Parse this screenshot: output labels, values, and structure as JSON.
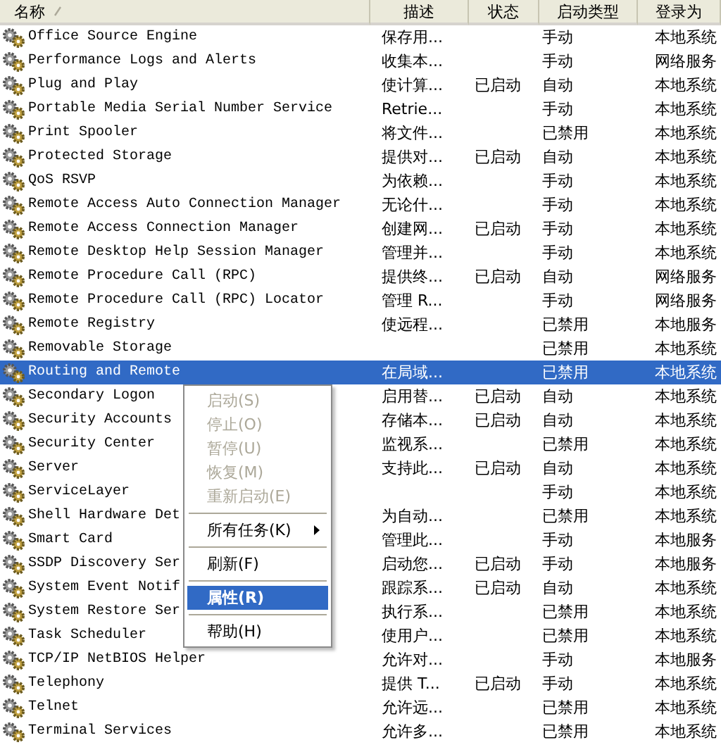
{
  "columns": [
    "名称",
    "描述",
    "状态",
    "启动类型",
    "登录为"
  ],
  "rows": [
    {
      "name": "Office Source Engine",
      "description": "保存用...",
      "status": "",
      "startup": "手动",
      "logon": "本地系统",
      "selected": false
    },
    {
      "name": "Performance Logs and Alerts",
      "description": "收集本...",
      "status": "",
      "startup": "手动",
      "logon": "网络服务",
      "selected": false
    },
    {
      "name": "Plug and Play",
      "description": "使计算...",
      "status": "已启动",
      "startup": "自动",
      "logon": "本地系统",
      "selected": false
    },
    {
      "name": "Portable Media Serial Number Service",
      "description": "Retrie...",
      "status": "",
      "startup": "手动",
      "logon": "本地系统",
      "selected": false
    },
    {
      "name": "Print Spooler",
      "description": "将文件...",
      "status": "",
      "startup": "已禁用",
      "logon": "本地系统",
      "selected": false
    },
    {
      "name": "Protected Storage",
      "description": "提供对...",
      "status": "已启动",
      "startup": "自动",
      "logon": "本地系统",
      "selected": false
    },
    {
      "name": "QoS RSVP",
      "description": "为依赖...",
      "status": "",
      "startup": "手动",
      "logon": "本地系统",
      "selected": false
    },
    {
      "name": "Remote Access Auto Connection Manager",
      "description": "无论什...",
      "status": "",
      "startup": "手动",
      "logon": "本地系统",
      "selected": false
    },
    {
      "name": "Remote Access Connection Manager",
      "description": "创建网...",
      "status": "已启动",
      "startup": "手动",
      "logon": "本地系统",
      "selected": false
    },
    {
      "name": "Remote Desktop Help Session Manager",
      "description": "管理并...",
      "status": "",
      "startup": "手动",
      "logon": "本地系统",
      "selected": false
    },
    {
      "name": "Remote Procedure Call (RPC)",
      "description": "提供终...",
      "status": "已启动",
      "startup": "自动",
      "logon": "网络服务",
      "selected": false
    },
    {
      "name": "Remote Procedure Call (RPC) Locator",
      "description": "管理 R...",
      "status": "",
      "startup": "手动",
      "logon": "网络服务",
      "selected": false
    },
    {
      "name": "Remote Registry",
      "description": "使远程...",
      "status": "",
      "startup": "已禁用",
      "logon": "本地服务",
      "selected": false
    },
    {
      "name": "Removable Storage",
      "description": "",
      "status": "",
      "startup": "已禁用",
      "logon": "本地系统",
      "selected": false
    },
    {
      "name": "Routing and Remote",
      "description": "在局域...",
      "status": "",
      "startup": "已禁用",
      "logon": "本地系统",
      "selected": true
    },
    {
      "name": "Secondary Logon",
      "description": "启用替...",
      "status": "已启动",
      "startup": "自动",
      "logon": "本地系统",
      "selected": false
    },
    {
      "name": "Security Accounts",
      "description": "存储本...",
      "status": "已启动",
      "startup": "自动",
      "logon": "本地系统",
      "selected": false
    },
    {
      "name": "Security Center",
      "description": "监视系...",
      "status": "",
      "startup": "已禁用",
      "logon": "本地系统",
      "selected": false
    },
    {
      "name": "Server",
      "description": "支持此...",
      "status": "已启动",
      "startup": "自动",
      "logon": "本地系统",
      "selected": false
    },
    {
      "name": "ServiceLayer",
      "description": "",
      "status": "",
      "startup": "手动",
      "logon": "本地系统",
      "selected": false
    },
    {
      "name": "Shell Hardware Det",
      "description": "为自动...",
      "status": "",
      "startup": "已禁用",
      "logon": "本地系统",
      "selected": false
    },
    {
      "name": "Smart Card",
      "description": "管理此...",
      "status": "",
      "startup": "手动",
      "logon": "本地服务",
      "selected": false
    },
    {
      "name": "SSDP Discovery Ser",
      "description": "启动您...",
      "status": "已启动",
      "startup": "手动",
      "logon": "本地服务",
      "selected": false
    },
    {
      "name": "System Event Notif",
      "description": "跟踪系...",
      "status": "已启动",
      "startup": "自动",
      "logon": "本地系统",
      "selected": false
    },
    {
      "name": "System Restore Ser",
      "description": "执行系...",
      "status": "",
      "startup": "已禁用",
      "logon": "本地系统",
      "selected": false
    },
    {
      "name": "Task Scheduler",
      "description": "使用户...",
      "status": "",
      "startup": "已禁用",
      "logon": "本地系统",
      "selected": false
    },
    {
      "name": "TCP/IP NetBIOS Helper",
      "description": "允许对...",
      "status": "",
      "startup": "手动",
      "logon": "本地服务",
      "selected": false
    },
    {
      "name": "Telephony",
      "description": "提供 T...",
      "status": "已启动",
      "startup": "手动",
      "logon": "本地系统",
      "selected": false
    },
    {
      "name": "Telnet",
      "description": "允许远...",
      "status": "",
      "startup": "已禁用",
      "logon": "本地系统",
      "selected": false
    },
    {
      "name": "Terminal Services",
      "description": "允许多...",
      "status": "",
      "startup": "已禁用",
      "logon": "本地系统",
      "selected": false
    }
  ],
  "context_menu": [
    {
      "kind": "item",
      "label": "启动(S)",
      "disabled": true,
      "selected": false
    },
    {
      "kind": "item",
      "label": "停止(O)",
      "disabled": true,
      "selected": false
    },
    {
      "kind": "item",
      "label": "暂停(U)",
      "disabled": true,
      "selected": false
    },
    {
      "kind": "item",
      "label": "恢复(M)",
      "disabled": true,
      "selected": false
    },
    {
      "kind": "item",
      "label": "重新启动(E)",
      "disabled": true,
      "selected": false
    },
    {
      "kind": "separator"
    },
    {
      "kind": "submenu",
      "label": "所有任务(K)",
      "disabled": false,
      "selected": false
    },
    {
      "kind": "separator"
    },
    {
      "kind": "item",
      "label": "刷新(F)",
      "disabled": false,
      "selected": false
    },
    {
      "kind": "separator"
    },
    {
      "kind": "item",
      "label": "属性(R)",
      "disabled": false,
      "selected": true
    },
    {
      "kind": "separator"
    },
    {
      "kind": "item",
      "label": "帮助(H)",
      "disabled": false,
      "selected": false
    }
  ]
}
